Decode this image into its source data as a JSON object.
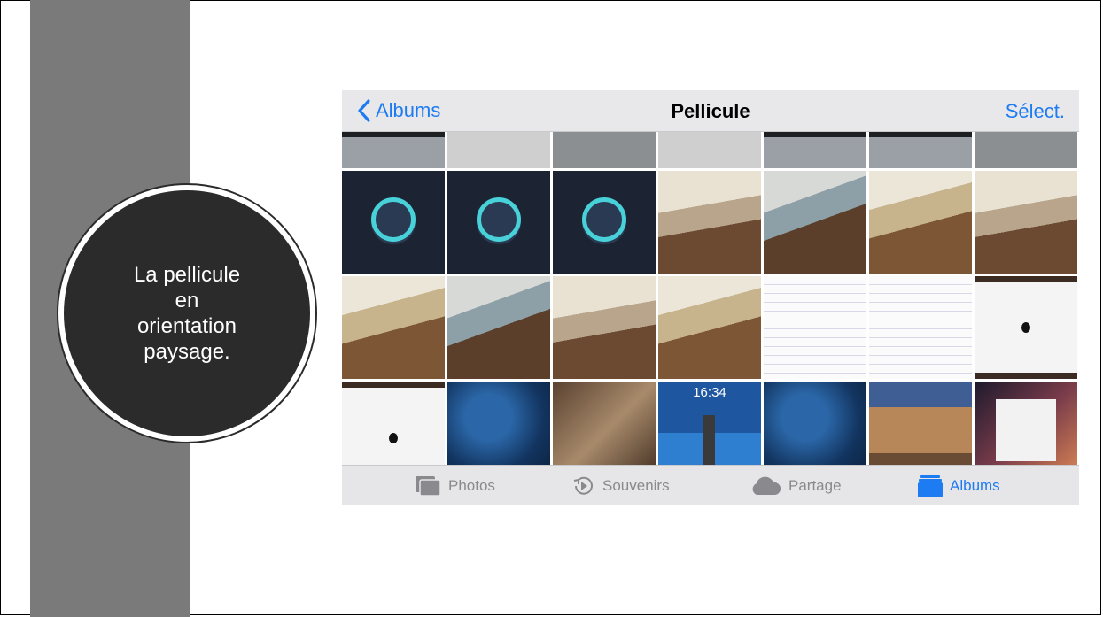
{
  "slide": {
    "caption": "La pellicule\nen\norientation\npaysage."
  },
  "navbar": {
    "back_label": "Albums",
    "title": "Pellicule",
    "select_label": "Sélect."
  },
  "lockscreen_time": "16:34",
  "tabs": [
    {
      "label": "Photos",
      "icon": "photos-icon",
      "active": false
    },
    {
      "label": "Souvenirs",
      "icon": "memories-icon",
      "active": false
    },
    {
      "label": "Partage",
      "icon": "cloud-icon",
      "active": false
    },
    {
      "label": "Albums",
      "icon": "albums-icon",
      "active": true
    }
  ],
  "colors": {
    "accent": "#1e7cf2",
    "sidebar": "#7a7a7a",
    "circle": "#2b2b2b"
  }
}
